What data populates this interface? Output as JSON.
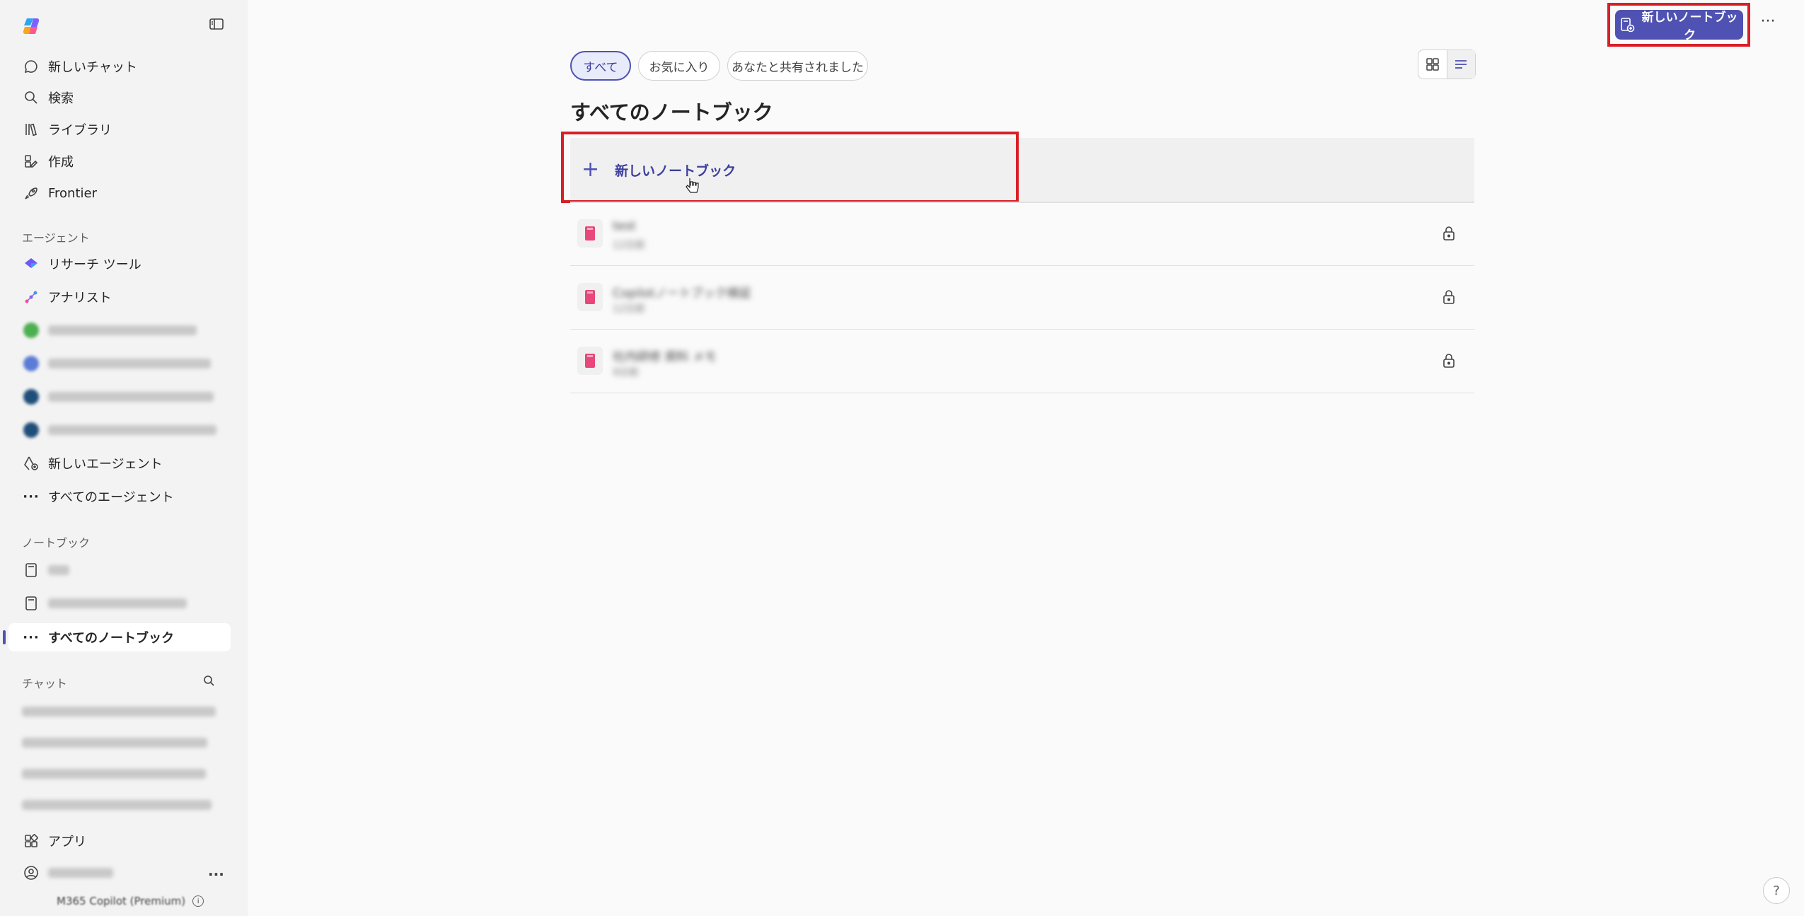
{
  "sidebar": {
    "nav": [
      {
        "label": "新しいチャット",
        "icon": "chat-icon"
      },
      {
        "label": "検索",
        "icon": "search-icon"
      },
      {
        "label": "ライブラリ",
        "icon": "library-icon"
      },
      {
        "label": "作成",
        "icon": "create-icon"
      },
      {
        "label": "Frontier",
        "icon": "rocket-icon"
      }
    ],
    "agents_label": "エージェント",
    "agents": [
      {
        "label": "リサーチ ツール",
        "icon": "research-icon"
      },
      {
        "label": "アナリスト",
        "icon": "analyst-icon"
      }
    ],
    "new_agent": "新しいエージェント",
    "all_agents": "すべてのエージェント",
    "notebooks_label": "ノートブック",
    "all_notebooks": "すべてのノートブック",
    "chat_label": "チャット",
    "apps": "アプリ",
    "footer": "M365 Copilot (Premium)"
  },
  "topbar": {
    "new_notebook": "新しいノートブック"
  },
  "main": {
    "tabs": [
      {
        "label": "すべて",
        "active": true
      },
      {
        "label": "お気に入り",
        "active": false
      },
      {
        "label": "あなたと共有されました",
        "active": false
      }
    ],
    "title": "すべてのノートブック",
    "new_notebook_row": "新しいノートブック",
    "notebooks": [
      {
        "name": "test",
        "sub": "12日前"
      },
      {
        "name": "Copilotノートブック検証",
        "sub": "12日前"
      },
      {
        "name": "社内研修 資料 メモ",
        "sub": "9日前"
      }
    ]
  },
  "colors": {
    "accent": "#4f52b2",
    "highlight_box": "#d81f26",
    "notebook_icon": "#e8477a"
  }
}
